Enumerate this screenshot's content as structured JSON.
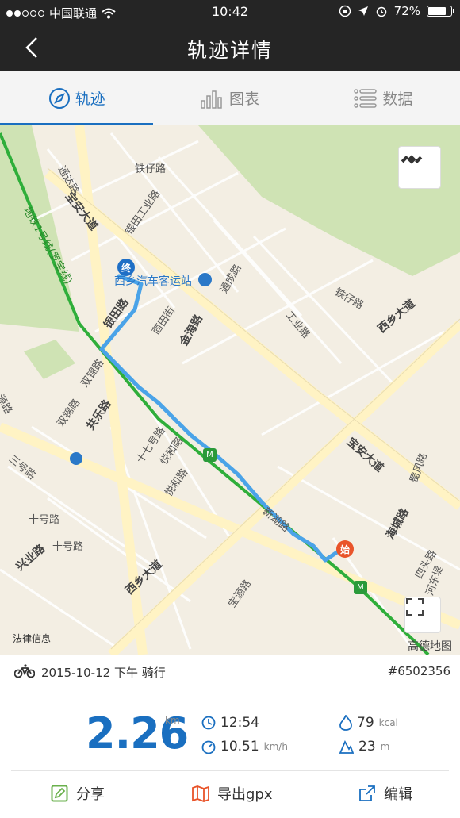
{
  "status_bar": {
    "carrier": "中国联通",
    "time": "10:42",
    "battery_percent": "72%",
    "battery_level": 0.72
  },
  "header": {
    "title": "轨迹详情"
  },
  "tabs": [
    {
      "label": "轨迹",
      "icon": "compass-icon",
      "active": true
    },
    {
      "label": "图表",
      "icon": "bar-chart-icon",
      "active": false
    },
    {
      "label": "数据",
      "icon": "list-icon",
      "active": false
    }
  ],
  "map": {
    "legal": "法律信息",
    "brand": "高德地图",
    "end_marker": "终",
    "start_marker": "始",
    "bus_station": "西乡汽车客运站",
    "labels": {
      "metro_line": "地铁1号线(罗宝线)",
      "baoan_avenue": "宝安大道",
      "baoan_avenue_2": "宝安大道",
      "tongda": "通达路",
      "tieling": "铁仔路",
      "yintian_industrial": "银田工业路",
      "yintian": "银田路",
      "tongcheng": "通成路",
      "jinhai": "金海路",
      "gongye": "工业路",
      "tiezai": "铁仔路",
      "xixiang_avenue": "西乡大道",
      "xixiang_avenue_2": "西乡大道",
      "gongle": "共乐路",
      "shuangjin": "双锦路",
      "shuangjin_2": "双锦路",
      "shiqi": "十七号路",
      "yuehe": "悦和路",
      "yuehe_2": "悦和路",
      "xinhu": "新湖路",
      "haicheng": "海城路",
      "shufeng": "蜀风路",
      "xingye": "兴业路",
      "baoyuan": "宝源路",
      "shihao": "十号路",
      "shihao_2": "十号路",
      "sanhao": "三号路",
      "yuanlu": "源路",
      "miantian": "茴田街",
      "sitou": "四头路",
      "hedong": "河东堤"
    }
  },
  "ride": {
    "date": "2015-10-12 下午 骑行",
    "record_id": "#6502356",
    "distance": "2.26",
    "distance_unit": "km",
    "duration": "12:54",
    "speed": "10.51",
    "speed_unit": "km/h",
    "calories": "79",
    "calories_unit": "kcal",
    "elevation": "23",
    "elevation_unit": "m"
  },
  "actions": {
    "share": "分享",
    "export": "导出gpx",
    "edit": "编辑"
  },
  "colors": {
    "accent": "#1a6fc0",
    "track": "#4aa3e8",
    "metro": "#2fae3a",
    "start": "#e9542a"
  }
}
